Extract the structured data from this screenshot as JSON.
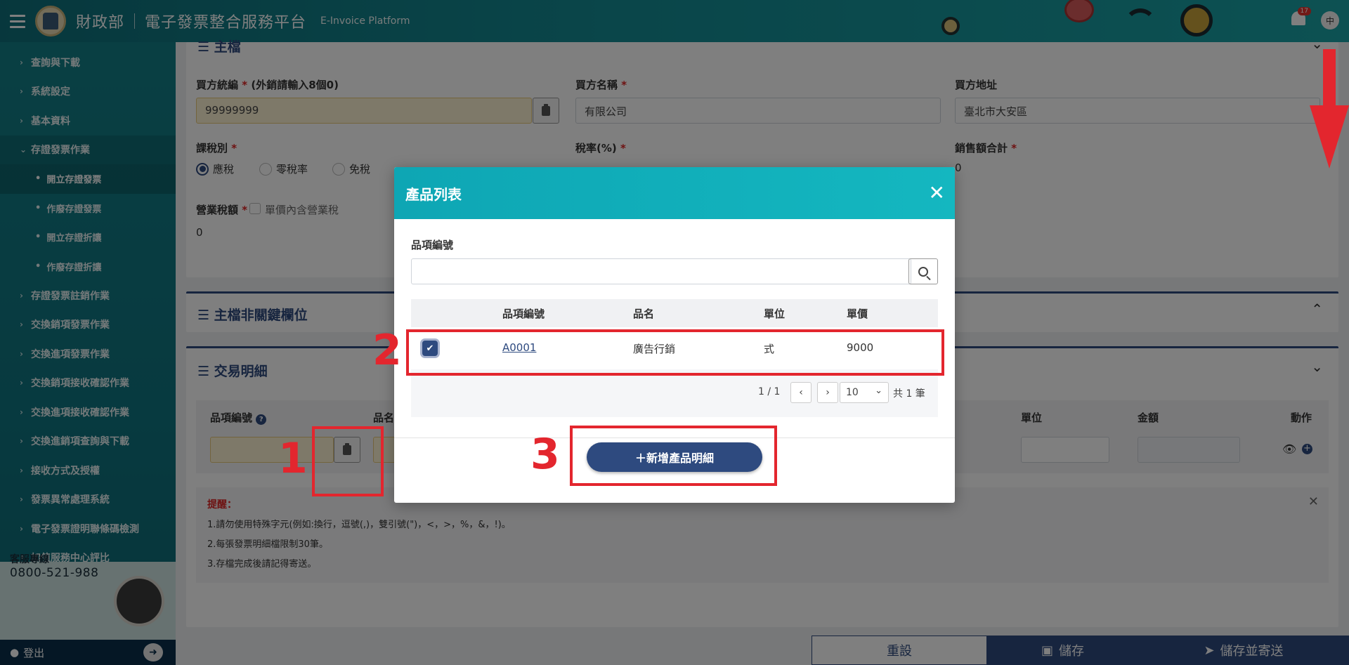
{
  "header": {
    "ministry": "財政部",
    "platform": "電子發票整合服務平台",
    "platform_en": "E-Invoice Platform",
    "notification_count": "17",
    "user_initial": "中"
  },
  "sidebar": {
    "items": [
      {
        "label": "查詢與下載"
      },
      {
        "label": "系統設定"
      },
      {
        "label": "基本資料"
      },
      {
        "label": "存證發票作業"
      },
      {
        "label": "開立存證發票"
      },
      {
        "label": "作廢存證發票"
      },
      {
        "label": "開立存證折讓"
      },
      {
        "label": "作廢存證折讓"
      },
      {
        "label": "存證發票註銷作業"
      },
      {
        "label": "交換銷項發票作業"
      },
      {
        "label": "交換進項發票作業"
      },
      {
        "label": "交換銷項接收確認作業"
      },
      {
        "label": "交換進項接收確認作業"
      },
      {
        "label": "交換進銷項查詢與下載"
      },
      {
        "label": "接收方式及授權"
      },
      {
        "label": "發票異常處理系統"
      },
      {
        "label": "電子發票證明聯條碼檢測"
      },
      {
        "label": "加值服務中心評比"
      }
    ],
    "service_label": "客服專線",
    "service_phone": "0800-521-988",
    "logout": "登出"
  },
  "main": {
    "section_master": "主檔",
    "buyer_id_label": "買方統編",
    "buyer_id_note": "(外銷請輸入8個0)",
    "buyer_id_value": "99999999",
    "buyer_name_label": "買方名稱",
    "buyer_name_value": "有限公司",
    "buyer_addr_label": "買方地址",
    "buyer_addr_value": "臺北市大安區",
    "tax_type_label": "課稅別",
    "tax_options": [
      "應稅",
      "零稅率",
      "免稅"
    ],
    "tax_rate_label": "稅率(%)",
    "sales_total_label": "銷售額合計",
    "sales_total_value": "0",
    "business_tax_label": "營業稅額",
    "price_incl_tax_label": "單價內含營業稅",
    "business_tax_value": "0",
    "section_nonkey": "主檔非關鍵欄位",
    "section_detail": "交易明細",
    "detail_headers": {
      "item_code": "品項編號",
      "item_name": "品名",
      "unit": "單位",
      "amount": "金額",
      "action": "動作"
    },
    "reminder_title": "提醒：",
    "reminders": [
      "1.請勿使用特殊字元(例如:換行，逗號(,)，雙引號(\")，<，>，%，&，!)。",
      "2.每張發票明細檔限制30筆。",
      "3.存檔完成後請記得寄送。"
    ],
    "btn_reset": "重設",
    "btn_save": "儲存",
    "btn_save_send": "儲存並寄送"
  },
  "modal": {
    "title": "產品列表",
    "search_label": "品項編號",
    "search_value": "",
    "columns": [
      "品項編號",
      "品名",
      "單位",
      "單價"
    ],
    "rows": [
      {
        "code": "A0001",
        "name": "廣告行銷",
        "unit": "式",
        "price": "9000",
        "checked": true
      }
    ],
    "page_text": "1 / 1",
    "page_size": "10",
    "total_text": "共 1 筆",
    "add_button": "＋新增產品明細"
  },
  "annotations": {
    "n1": "1",
    "n2": "2",
    "n3": "3"
  },
  "colors": {
    "primary": "#2e4a7f",
    "teal": "#14b7c0",
    "annotation": "#e3262e"
  }
}
